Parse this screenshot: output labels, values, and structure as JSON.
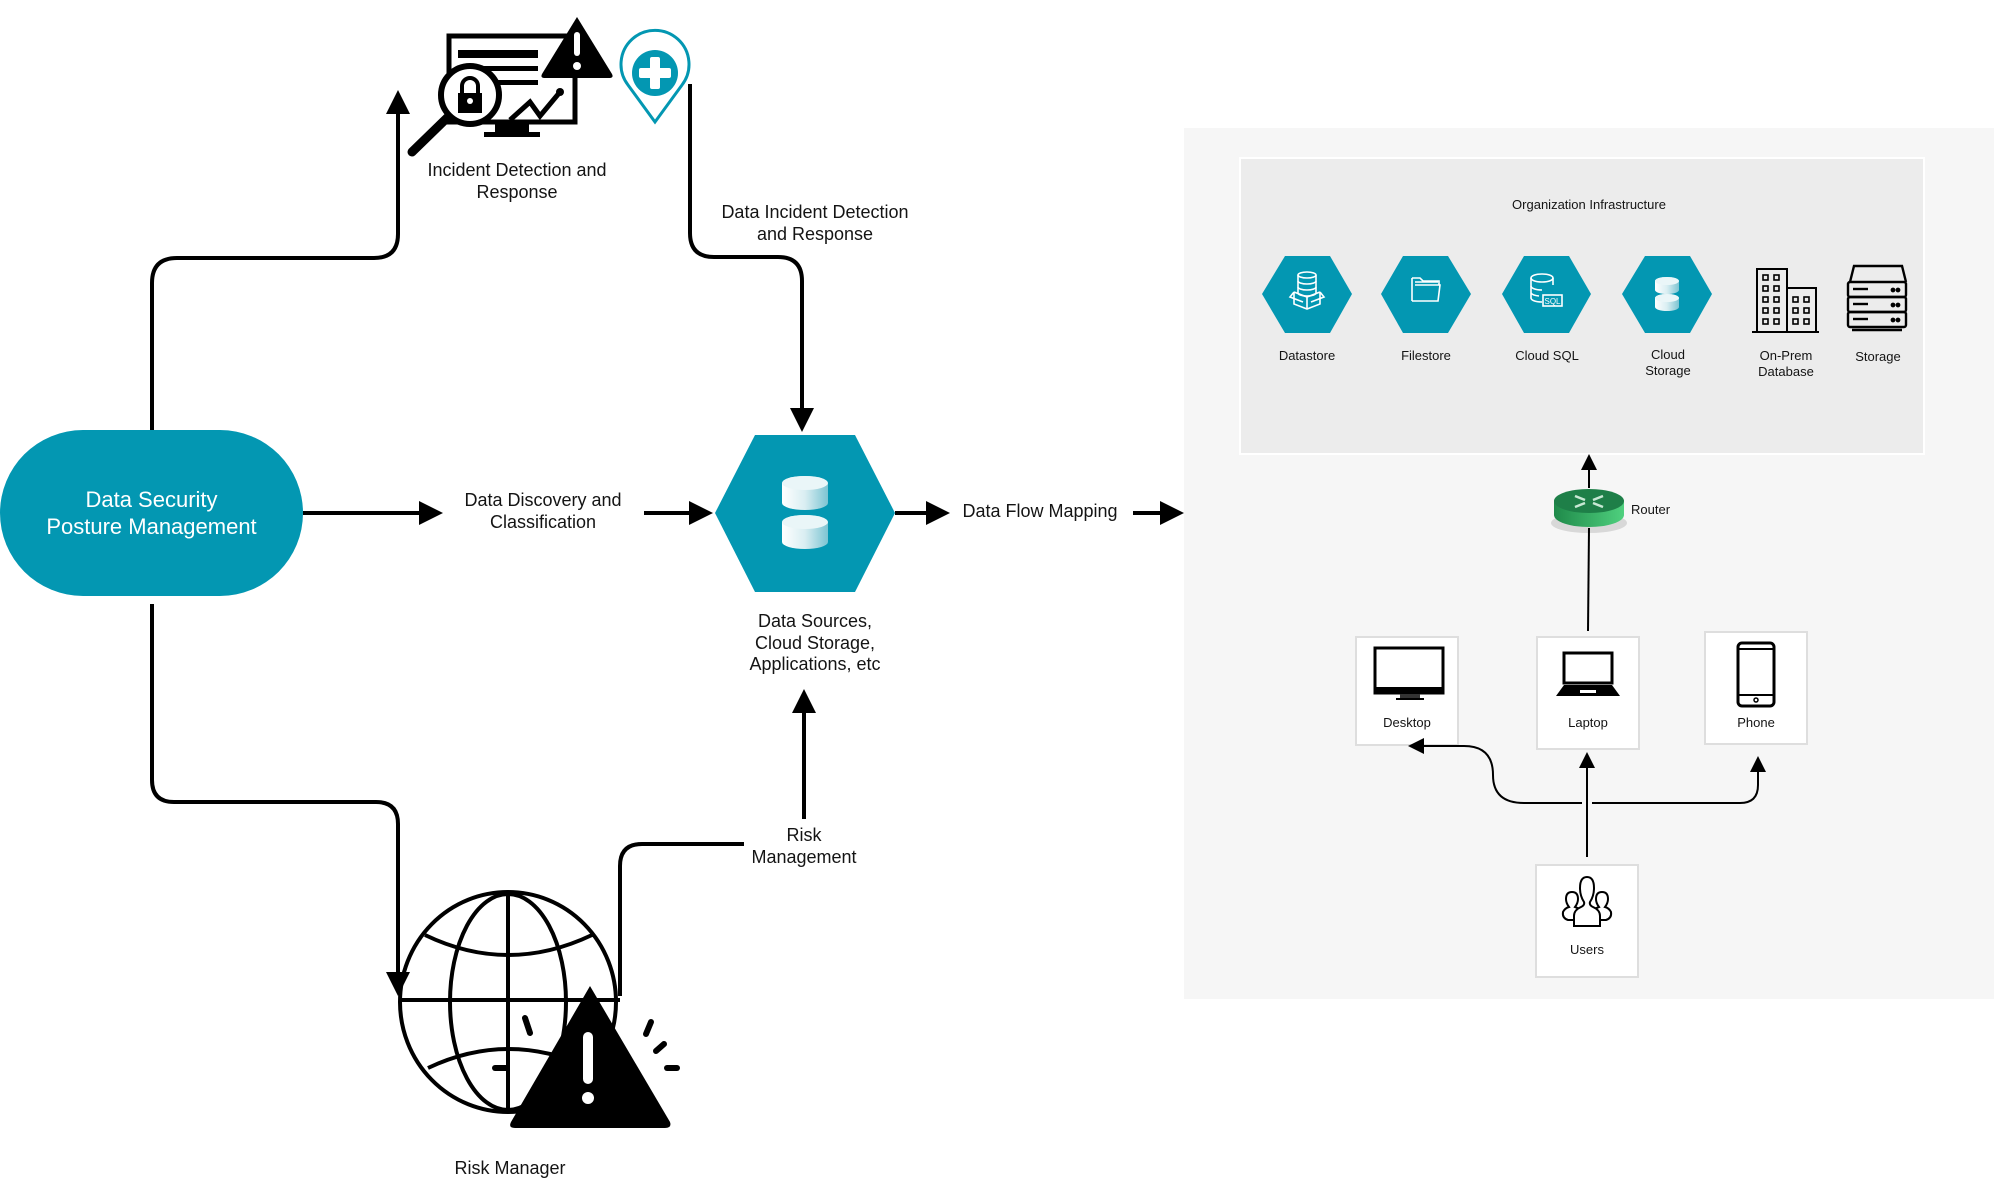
{
  "colors": {
    "teal": "#0397b2",
    "line": "#000000",
    "panel_bg": "#f6f6f6",
    "infra_bg": "#ececec",
    "router_green": "#2fa85c"
  },
  "dspm": {
    "label": "Data Security\nPosture Management"
  },
  "flow": {
    "incident_label": "Incident Detection and\nResponse",
    "data_incident_label": "Data Incident Detection\nand Response",
    "discovery_label": "Data Discovery and\nClassification",
    "data_sources_label": "Data Sources,\nCloud Storage,\nApplications, etc",
    "data_flow_label": "Data Flow Mapping",
    "risk_management_label": "Risk\nManagement",
    "risk_manager_label": "Risk Manager"
  },
  "icons": {
    "incident": "monitor-lock-alert-icon",
    "pin": "medical-pin-icon",
    "data_sources": "database-icon",
    "risk_manager": "globe-warning-icon"
  },
  "infrastructure": {
    "title": "Organization Infrastructure",
    "items": [
      {
        "label": "Datastore",
        "icon": "datastore-icon"
      },
      {
        "label": "Filestore",
        "icon": "filestore-icon"
      },
      {
        "label": "Cloud SQL",
        "icon": "cloud-sql-icon"
      },
      {
        "label": "Cloud\nStorage",
        "icon": "cloud-storage-icon"
      },
      {
        "label": "On-Prem\nDatabase",
        "icon": "building-icon"
      },
      {
        "label": "Storage",
        "icon": "server-icon"
      }
    ]
  },
  "network": {
    "router_label": "Router",
    "devices": [
      {
        "label": "Desktop",
        "icon": "desktop-icon"
      },
      {
        "label": "Laptop",
        "icon": "laptop-icon"
      },
      {
        "label": "Phone",
        "icon": "phone-icon"
      }
    ],
    "users_label": "Users"
  }
}
